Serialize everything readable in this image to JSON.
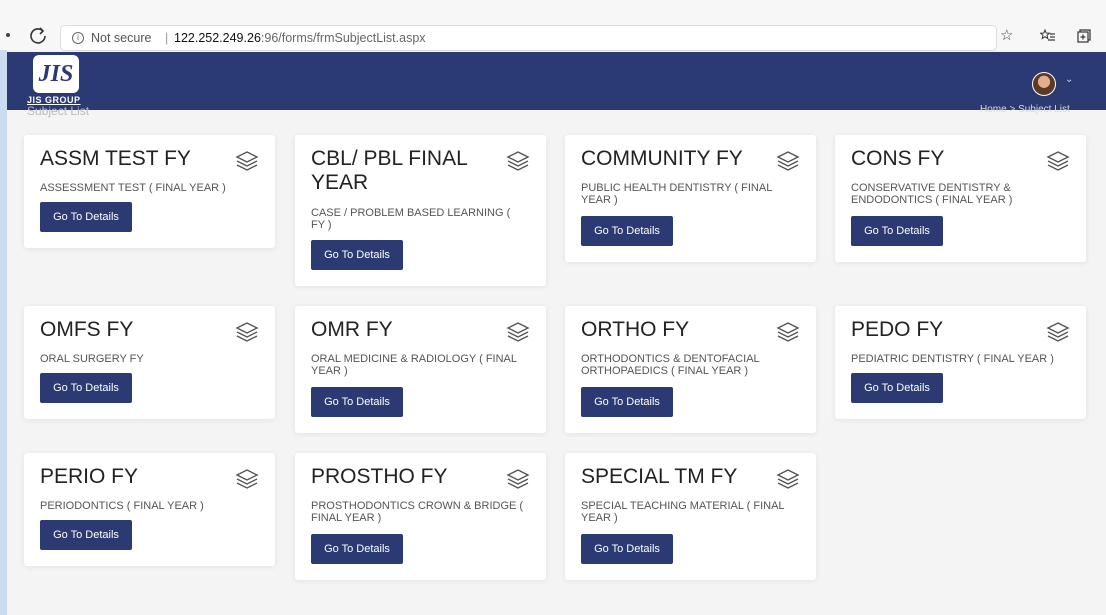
{
  "browser": {
    "info_glyph": "i",
    "not_secure": "Not secure",
    "separator": "|",
    "url_host": "122.252.249.26",
    "url_path": ":96/forms/frmSubjectList.aspx"
  },
  "header": {
    "logo_letters": "JIS",
    "logo_text": "JIS GROUP",
    "page_title": "Subject List",
    "breadcrumb": "Home > Subject List"
  },
  "cards": [
    {
      "title": "ASSM TEST FY",
      "desc": "ASSESSMENT TEST ( FINAL YEAR )",
      "button": "Go To Details"
    },
    {
      "title": "CBL/ PBL FINAL YEAR",
      "desc": "CASE / PROBLEM BASED LEARNING ( FY )",
      "button": "Go To Details"
    },
    {
      "title": "COMMUNITY FY",
      "desc": "PUBLIC HEALTH DENTISTRY ( FINAL YEAR )",
      "button": "Go To Details"
    },
    {
      "title": "CONS FY",
      "desc": "CONSERVATIVE DENTISTRY & ENDODONTICS ( FINAL YEAR )",
      "button": "Go To Details"
    },
    {
      "title": "OMFS FY",
      "desc": "ORAL SURGERY FY",
      "button": "Go To Details"
    },
    {
      "title": "OMR FY",
      "desc": "ORAL MEDICINE & RADIOLOGY ( FINAL YEAR )",
      "button": "Go To Details"
    },
    {
      "title": "ORTHO FY",
      "desc": "ORTHODONTICS & DENTOFACIAL ORTHOPAEDICS ( FINAL YEAR )",
      "button": "Go To Details"
    },
    {
      "title": "PEDO FY",
      "desc": "PEDIATRIC DENTISTRY ( FINAL YEAR )",
      "button": "Go To Details"
    },
    {
      "title": "PERIO FY",
      "desc": "PERIODONTICS ( FINAL YEAR )",
      "button": "Go To Details"
    },
    {
      "title": "PROSTHO FY",
      "desc": "PROSTHODONTICS CROWN & BRIDGE ( FINAL YEAR )",
      "button": "Go To Details"
    },
    {
      "title": "SPECIAL TM FY",
      "desc": "SPECIAL TEACHING MATERIAL ( FINAL YEAR )",
      "button": "Go To Details"
    }
  ],
  "colors": {
    "header_bg": "#2b3a73",
    "button_bg": "#2b3a73"
  },
  "icons": {
    "card_icon": "layers-icon",
    "refresh": "refresh-icon",
    "star": "star-icon",
    "favorites": "favorites-icon",
    "collections": "collections-icon"
  }
}
